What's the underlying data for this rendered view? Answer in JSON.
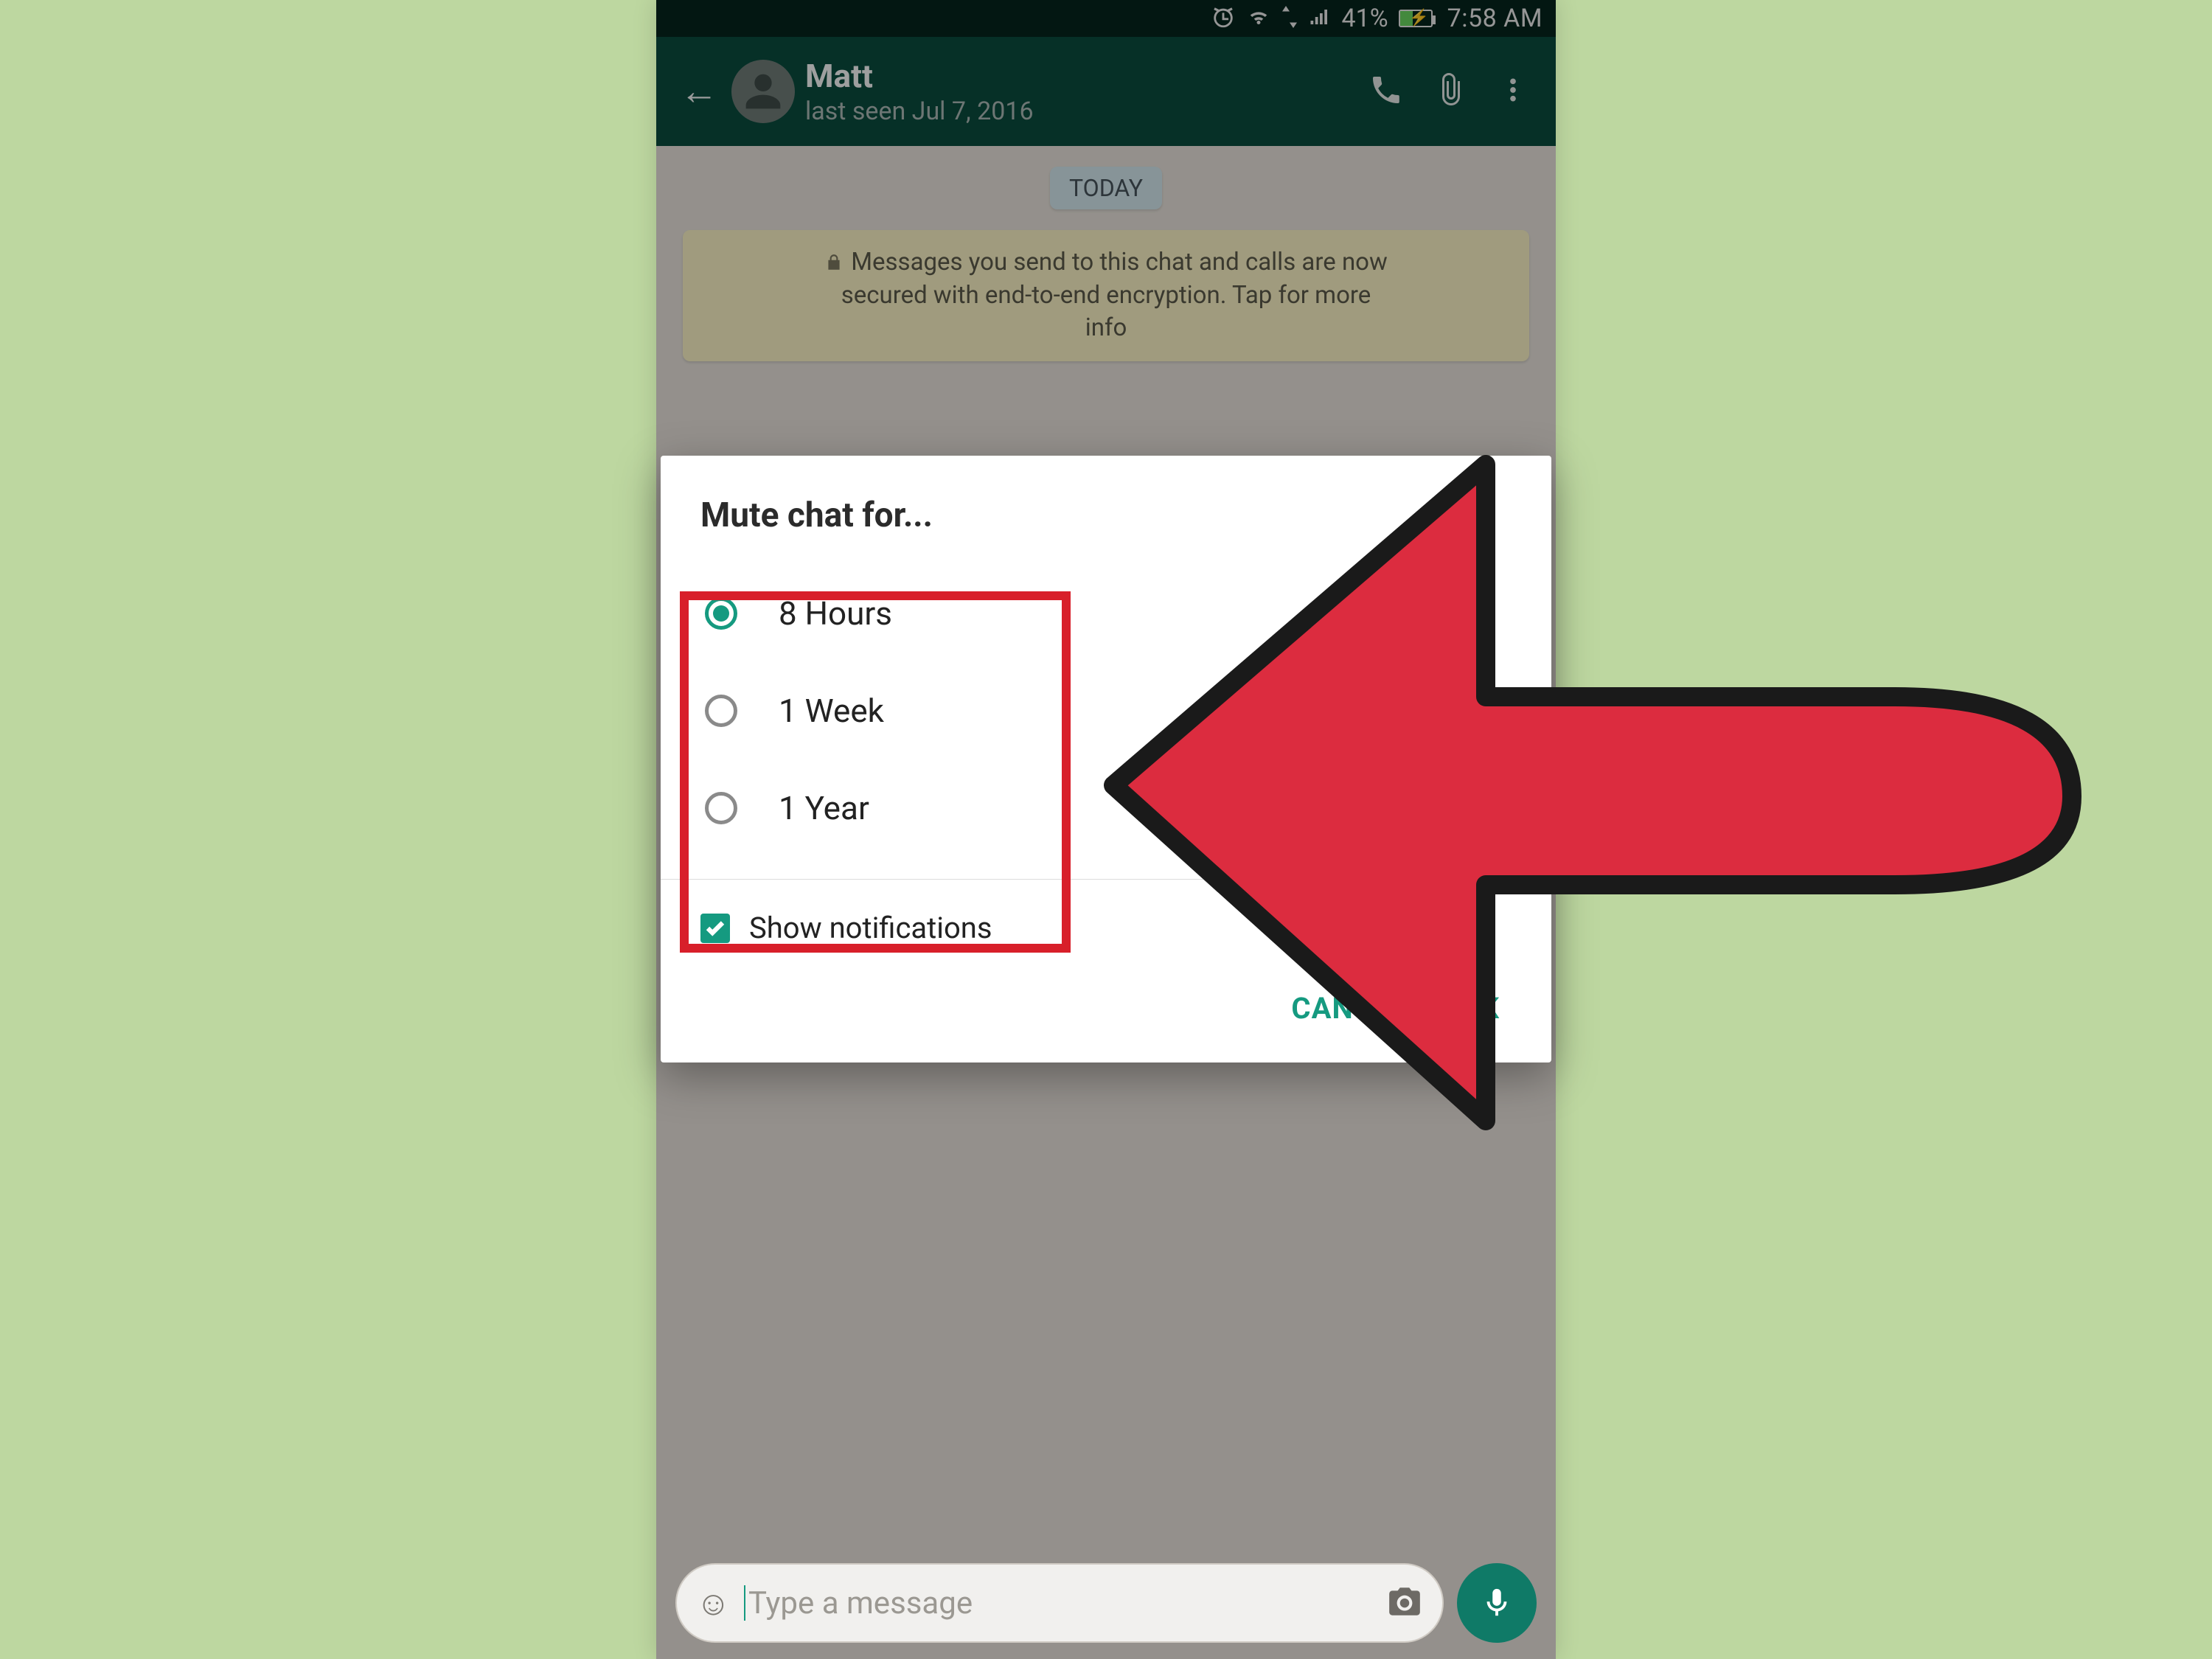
{
  "status": {
    "battery": "41%",
    "time": "7:58 AM"
  },
  "header": {
    "name": "Matt",
    "last_seen": "last seen Jul 7, 2016"
  },
  "chat": {
    "date_label": "TODAY",
    "e2e_line1": "Messages you send to this chat and calls are now",
    "e2e_line2": "secured with end-to-end encryption. Tap for more",
    "e2e_line3": "info"
  },
  "dialog": {
    "title": "Mute chat for...",
    "options": [
      "8 Hours",
      "1 Week",
      "1 Year"
    ],
    "show_notifications": "Show notifications",
    "cancel": "CANCEL",
    "ok": "OK"
  },
  "composer": {
    "placeholder": "Type a message"
  }
}
